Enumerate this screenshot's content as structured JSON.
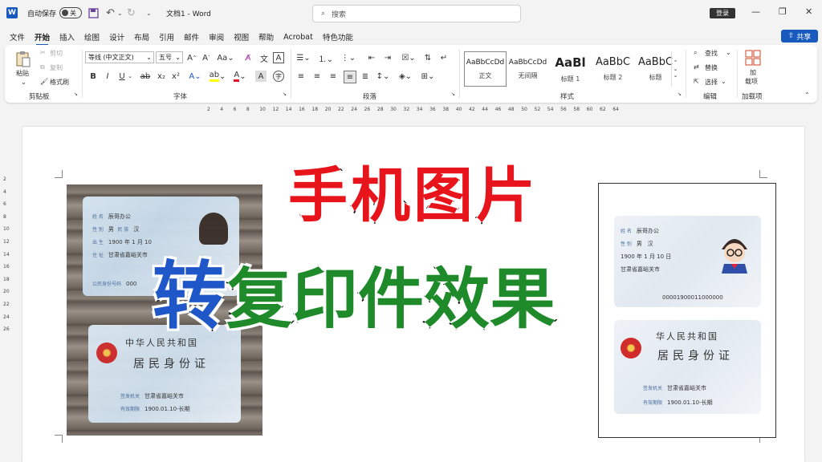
{
  "titlebar": {
    "autosave_label": "自动保存",
    "autosave_state": "关",
    "doc_title": "文档1 - Word",
    "search_placeholder": "搜索",
    "login_label": "登录",
    "minimize": "—",
    "restore": "❐",
    "close": "✕"
  },
  "menu": {
    "items": [
      "文件",
      "开始",
      "插入",
      "绘图",
      "设计",
      "布局",
      "引用",
      "邮件",
      "审阅",
      "视图",
      "帮助",
      "Acrobat",
      "特色功能"
    ],
    "active_index": 1,
    "share_label": "共享"
  },
  "ribbon": {
    "clipboard": {
      "paste": "粘贴",
      "cut": "剪切",
      "copy": "复制",
      "format_painter": "格式刷",
      "group_label": "剪贴板"
    },
    "font": {
      "font_name": "等线 (中文正文)",
      "font_size": "五号",
      "group_label": "字体"
    },
    "paragraph": {
      "group_label": "段落"
    },
    "styles": {
      "items": [
        {
          "sample": "AaBbCcDd",
          "name": "正文"
        },
        {
          "sample": "AaBbCcDd",
          "name": "无间隔"
        },
        {
          "sample": "AaBl",
          "name": "标题 1"
        },
        {
          "sample": "AaBbC",
          "name": "标题 2"
        },
        {
          "sample": "AaBbC",
          "name": "标题"
        }
      ],
      "group_label": "样式"
    },
    "editing": {
      "find": "查找",
      "replace": "替换",
      "select": "选择",
      "group_label": "编辑"
    },
    "addins": {
      "button_line1": "加",
      "button_line2": "载项",
      "group_label": "加载项"
    }
  },
  "ruler": {
    "marks": [
      "2",
      "4",
      "6",
      "8",
      "10",
      "12",
      "14",
      "16",
      "18",
      "20",
      "22",
      "24",
      "26",
      "28",
      "30",
      "32",
      "34",
      "36",
      "38",
      "40",
      "42",
      "44",
      "46",
      "48",
      "50",
      "52",
      "54",
      "56",
      "58",
      "60",
      "62",
      "64"
    ],
    "vmarks": [
      "2",
      "4",
      "6",
      "8",
      "10",
      "12",
      "14",
      "16",
      "18",
      "20",
      "22",
      "24",
      "26"
    ]
  },
  "document": {
    "photo_front": {
      "name_label": "姓 名",
      "name_value": "辰哥办公",
      "sex_label": "性 别",
      "sex_value": "男",
      "ethnic_label": "民 族",
      "ethnic_value": "汉",
      "birth_label": "出 生",
      "birth_value": "1900 年 1 月 10",
      "address_label": "住 址",
      "address_value": "甘肃省嘉峪关市",
      "id_label": "公民身份号码",
      "id_value": "000"
    },
    "photo_back": {
      "title1": "中华人民共和国",
      "title2": "居民身份证",
      "authority_label": "签发机关",
      "authority_value": "甘肃省嘉峪关市",
      "validity_label": "有效期限",
      "validity_value": "1900.01.10-长期"
    },
    "copy_front": {
      "name_label": "姓 名",
      "name_value": "辰哥办公",
      "sex_label": "性 别",
      "sex_value": "男",
      "ethnic_value": "汉",
      "birth_value": "1900 年 1 月 10 日",
      "address_value": "甘肃省嘉峪关市",
      "id_value": "00001900011000000"
    },
    "copy_back": {
      "title1": "华人民共和国",
      "title2": "居民身份证",
      "authority_label": "签发机关",
      "authority_value": "甘肃省嘉峪关市",
      "validity_label": "有效期限",
      "validity_value": "1900.01.10-长期"
    }
  },
  "overlay": {
    "line1": "手机图片",
    "line2_blue": "转",
    "line2_green": "复印件效果",
    "colors": {
      "red": "#e8141b",
      "blue": "#1f57c9",
      "green": "#1e8a2a"
    }
  },
  "colors": {
    "accent": "#185abd"
  }
}
